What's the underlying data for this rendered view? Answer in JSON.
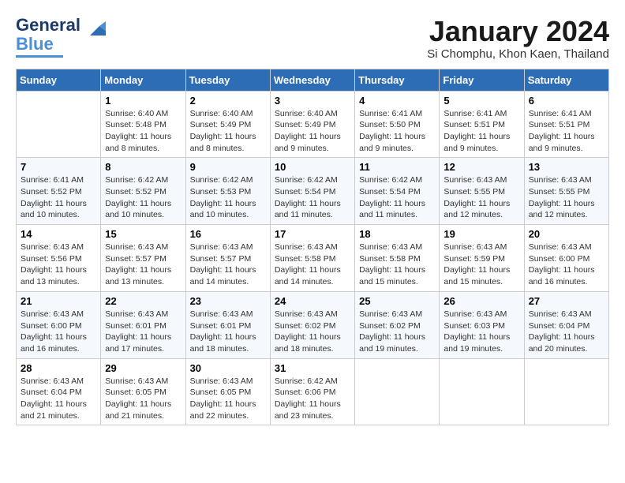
{
  "header": {
    "logo_line1": "General",
    "logo_line2": "Blue",
    "month_title": "January 2024",
    "location": "Si Chomphu, Khon Kaen, Thailand"
  },
  "days_of_week": [
    "Sunday",
    "Monday",
    "Tuesday",
    "Wednesday",
    "Thursday",
    "Friday",
    "Saturday"
  ],
  "weeks": [
    [
      {
        "day": "",
        "info": ""
      },
      {
        "day": "1",
        "info": "Sunrise: 6:40 AM\nSunset: 5:48 PM\nDaylight: 11 hours\nand 8 minutes."
      },
      {
        "day": "2",
        "info": "Sunrise: 6:40 AM\nSunset: 5:49 PM\nDaylight: 11 hours\nand 8 minutes."
      },
      {
        "day": "3",
        "info": "Sunrise: 6:40 AM\nSunset: 5:49 PM\nDaylight: 11 hours\nand 9 minutes."
      },
      {
        "day": "4",
        "info": "Sunrise: 6:41 AM\nSunset: 5:50 PM\nDaylight: 11 hours\nand 9 minutes."
      },
      {
        "day": "5",
        "info": "Sunrise: 6:41 AM\nSunset: 5:51 PM\nDaylight: 11 hours\nand 9 minutes."
      },
      {
        "day": "6",
        "info": "Sunrise: 6:41 AM\nSunset: 5:51 PM\nDaylight: 11 hours\nand 9 minutes."
      }
    ],
    [
      {
        "day": "7",
        "info": "Sunrise: 6:41 AM\nSunset: 5:52 PM\nDaylight: 11 hours\nand 10 minutes."
      },
      {
        "day": "8",
        "info": "Sunrise: 6:42 AM\nSunset: 5:52 PM\nDaylight: 11 hours\nand 10 minutes."
      },
      {
        "day": "9",
        "info": "Sunrise: 6:42 AM\nSunset: 5:53 PM\nDaylight: 11 hours\nand 10 minutes."
      },
      {
        "day": "10",
        "info": "Sunrise: 6:42 AM\nSunset: 5:54 PM\nDaylight: 11 hours\nand 11 minutes."
      },
      {
        "day": "11",
        "info": "Sunrise: 6:42 AM\nSunset: 5:54 PM\nDaylight: 11 hours\nand 11 minutes."
      },
      {
        "day": "12",
        "info": "Sunrise: 6:43 AM\nSunset: 5:55 PM\nDaylight: 11 hours\nand 12 minutes."
      },
      {
        "day": "13",
        "info": "Sunrise: 6:43 AM\nSunset: 5:55 PM\nDaylight: 11 hours\nand 12 minutes."
      }
    ],
    [
      {
        "day": "14",
        "info": "Sunrise: 6:43 AM\nSunset: 5:56 PM\nDaylight: 11 hours\nand 13 minutes."
      },
      {
        "day": "15",
        "info": "Sunrise: 6:43 AM\nSunset: 5:57 PM\nDaylight: 11 hours\nand 13 minutes."
      },
      {
        "day": "16",
        "info": "Sunrise: 6:43 AM\nSunset: 5:57 PM\nDaylight: 11 hours\nand 14 minutes."
      },
      {
        "day": "17",
        "info": "Sunrise: 6:43 AM\nSunset: 5:58 PM\nDaylight: 11 hours\nand 14 minutes."
      },
      {
        "day": "18",
        "info": "Sunrise: 6:43 AM\nSunset: 5:58 PM\nDaylight: 11 hours\nand 15 minutes."
      },
      {
        "day": "19",
        "info": "Sunrise: 6:43 AM\nSunset: 5:59 PM\nDaylight: 11 hours\nand 15 minutes."
      },
      {
        "day": "20",
        "info": "Sunrise: 6:43 AM\nSunset: 6:00 PM\nDaylight: 11 hours\nand 16 minutes."
      }
    ],
    [
      {
        "day": "21",
        "info": "Sunrise: 6:43 AM\nSunset: 6:00 PM\nDaylight: 11 hours\nand 16 minutes."
      },
      {
        "day": "22",
        "info": "Sunrise: 6:43 AM\nSunset: 6:01 PM\nDaylight: 11 hours\nand 17 minutes."
      },
      {
        "day": "23",
        "info": "Sunrise: 6:43 AM\nSunset: 6:01 PM\nDaylight: 11 hours\nand 18 minutes."
      },
      {
        "day": "24",
        "info": "Sunrise: 6:43 AM\nSunset: 6:02 PM\nDaylight: 11 hours\nand 18 minutes."
      },
      {
        "day": "25",
        "info": "Sunrise: 6:43 AM\nSunset: 6:02 PM\nDaylight: 11 hours\nand 19 minutes."
      },
      {
        "day": "26",
        "info": "Sunrise: 6:43 AM\nSunset: 6:03 PM\nDaylight: 11 hours\nand 19 minutes."
      },
      {
        "day": "27",
        "info": "Sunrise: 6:43 AM\nSunset: 6:04 PM\nDaylight: 11 hours\nand 20 minutes."
      }
    ],
    [
      {
        "day": "28",
        "info": "Sunrise: 6:43 AM\nSunset: 6:04 PM\nDaylight: 11 hours\nand 21 minutes."
      },
      {
        "day": "29",
        "info": "Sunrise: 6:43 AM\nSunset: 6:05 PM\nDaylight: 11 hours\nand 21 minutes."
      },
      {
        "day": "30",
        "info": "Sunrise: 6:43 AM\nSunset: 6:05 PM\nDaylight: 11 hours\nand 22 minutes."
      },
      {
        "day": "31",
        "info": "Sunrise: 6:42 AM\nSunset: 6:06 PM\nDaylight: 11 hours\nand 23 minutes."
      },
      {
        "day": "",
        "info": ""
      },
      {
        "day": "",
        "info": ""
      },
      {
        "day": "",
        "info": ""
      }
    ]
  ]
}
